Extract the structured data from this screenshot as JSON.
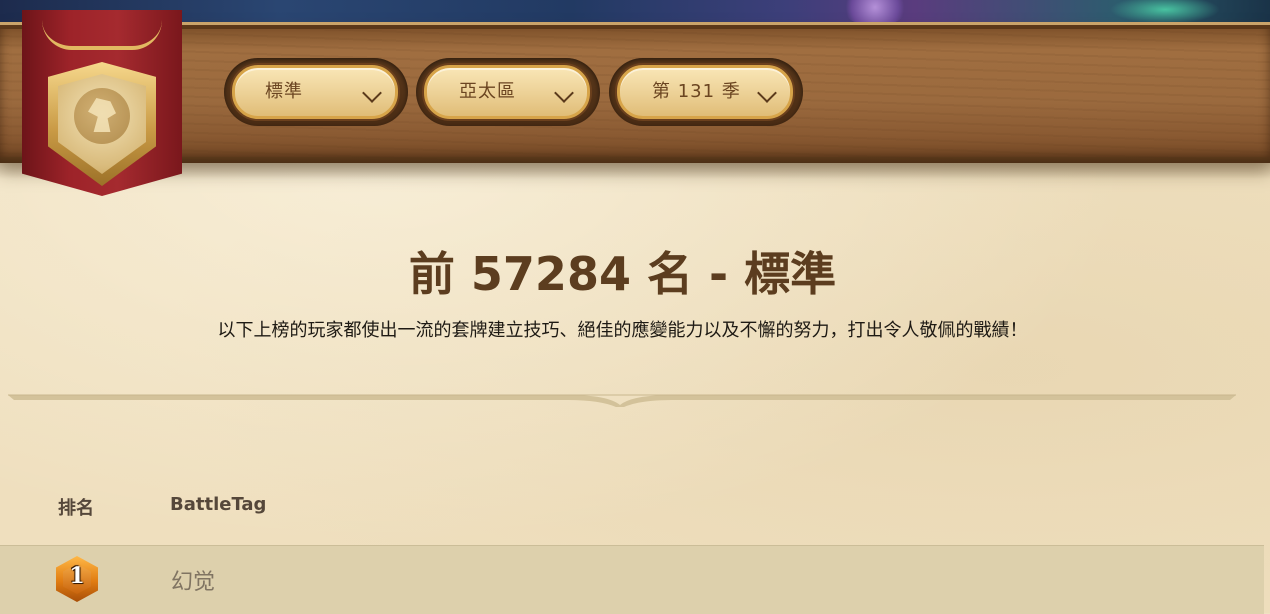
{
  "filters": {
    "mode": "標準",
    "region": "亞太區",
    "season": "第 131 季"
  },
  "heading": {
    "title": "前 57284 名 - 標準",
    "subtitle": "以下上榜的玩家都使出一流的套牌建立技巧、絕佳的應變能力以及不懈的努力，打出令人敬佩的戰績！"
  },
  "table": {
    "columns": [
      "排名",
      "BattleTag"
    ],
    "rows": [
      {
        "rank": "1",
        "battletag": "幻觉"
      }
    ]
  },
  "icons": {
    "crest": "pegasus-shield-banner-icon",
    "dropdown": "chevron-down-icon",
    "rank_badge": "hexagon-gem-icon"
  },
  "colors": {
    "plank": "#9b6a3e",
    "banner": "#9d2329",
    "parchment": "#efe0bf",
    "title": "#5c3d1f",
    "rank_badge": "#e07c12"
  }
}
